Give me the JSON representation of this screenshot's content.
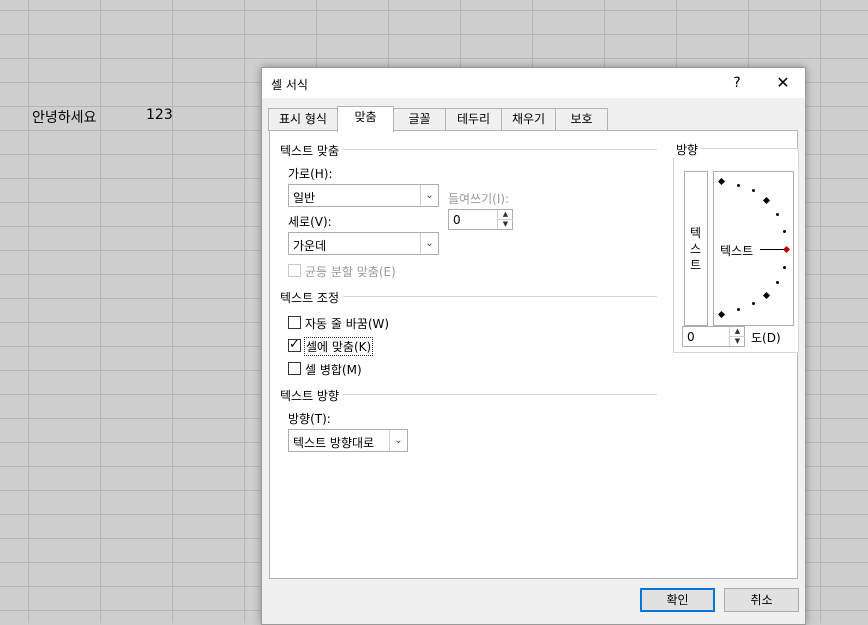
{
  "sheet": {
    "cell_a": "안녕하세요",
    "cell_b": "123"
  },
  "dialog": {
    "title": "셀 서식",
    "help": "?",
    "close": "✕",
    "tabs": [
      "표시 형식",
      "맞춤",
      "글꼴",
      "테두리",
      "채우기",
      "보호"
    ],
    "active_tab": "맞춤",
    "text_align": {
      "section": "텍스트 맞춤",
      "horizontal_label": "가로(H):",
      "horizontal_value": "일반",
      "indent_label": "들여쓰기(I):",
      "indent_value": "0",
      "vertical_label": "세로(V):",
      "vertical_value": "가운데",
      "justify_distributed": "균등 분할 맞춤(E)"
    },
    "text_control": {
      "section": "텍스트 조정",
      "wrap_text": "자동 줄 바꿈(W)",
      "wrap_text_checked": false,
      "shrink_to_fit": "셀에 맞춤(K)",
      "shrink_to_fit_checked": true,
      "merge_cells": "셀 병합(M)",
      "merge_cells_checked": false
    },
    "text_direction": {
      "section": "텍스트 방향",
      "direction_label": "방향(T):",
      "direction_value": "텍스트 방향대로"
    },
    "orientation": {
      "section": "방향",
      "vertical_chars": [
        "텍",
        "스",
        "트"
      ],
      "dial_text": "텍스트",
      "degrees_value": "0",
      "degrees_label": "도(D)"
    },
    "ok": "확인",
    "cancel": "취소"
  },
  "icons": {
    "dropdown": "chevron-down-icon",
    "spin_up": "spin-up-icon",
    "spin_down": "spin-down-icon",
    "check": "checkmark-icon"
  },
  "colors": {
    "default_button_border": "#0078d7",
    "orientation_marker": "#c00000"
  }
}
